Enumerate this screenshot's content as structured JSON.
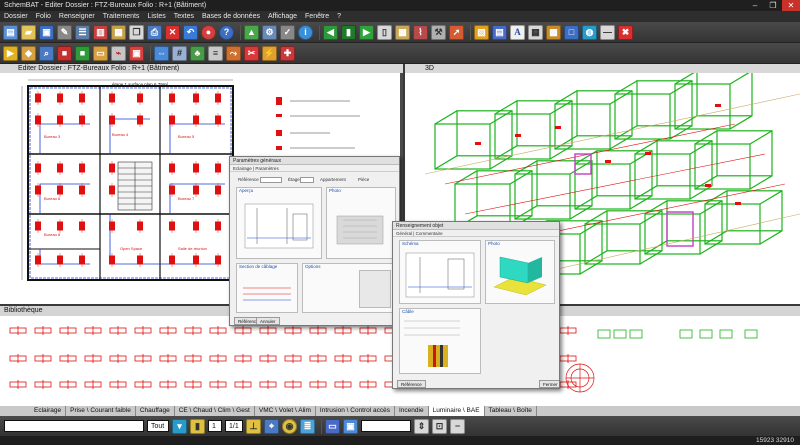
{
  "window": {
    "title": "SchemBAT - Editer  Dossier : FTZ-Bureaux  Folio : R+1  (Bâtiment)",
    "controls": [
      "–",
      "❐",
      "✕"
    ]
  },
  "menu": [
    "Dossier",
    "Folio",
    "Renseigner",
    "Traitements",
    "Listes",
    "Textes",
    "Bases de données",
    "Affichage",
    "Fenêtre",
    "?"
  ],
  "toolbar_text": {
    "font_a": "A"
  },
  "panes": {
    "left_tab": "Editer  Dossier : FTZ-Bureaux  Folio : R+1  (Bâtiment)",
    "right_tab": "3D",
    "plan_caption": "étage 1 surface plan 6.79m²",
    "room_labels": [
      "Bureau 3",
      "Bureau 4",
      "Bureau 5",
      "Bureau 6",
      "Bureau 7",
      "Bureau 8",
      "Open Space",
      "Salle de réunion"
    ]
  },
  "dialog_main": {
    "title": "Paramètres généraux",
    "tabs": "Eclairage | Paramètres",
    "fields": [
      "Référence",
      "Étage",
      "Appartement",
      "Pièce"
    ],
    "preview_label": "Aperçu",
    "group_photo": "Photo",
    "group_section": "Section de câblage",
    "group_options": "Options",
    "buttons": [
      "Référence",
      "Annuler"
    ]
  },
  "dialog_second": {
    "title": "Renseignement objet",
    "tabs": "Général | Commentaire",
    "group_schema": "Schéma",
    "group_photo": "Photo",
    "group_cable": "Câble",
    "buttons": [
      "Référence",
      "Fermer"
    ]
  },
  "library": {
    "header": "Bibliothèque"
  },
  "categories": [
    {
      "label": "Eclairage",
      "active": false
    },
    {
      "label": "Prise \\ Courant faible",
      "active": false
    },
    {
      "label": "Chauffage",
      "active": false
    },
    {
      "label": "CE \\ Chaud \\ Clim \\ Gest",
      "active": false
    },
    {
      "label": "VMC \\ Volet \\ Alim",
      "active": false
    },
    {
      "label": "Intrusion \\ Control accès",
      "active": false
    },
    {
      "label": "Incendie",
      "active": false
    },
    {
      "label": "Luminaire \\ BAE",
      "active": true
    },
    {
      "label": "Tableau \\ Boîte",
      "active": false
    }
  ],
  "bottom": {
    "layer": "Tout",
    "page": "1",
    "page_of": "1/1"
  },
  "status": {
    "coords": "15923  32910"
  },
  "colors": {
    "plan_red": "#e01010",
    "plan_blue": "#1a3fd6",
    "green_3d": "#1db31d",
    "bg_dark": "#3a3a3a"
  }
}
